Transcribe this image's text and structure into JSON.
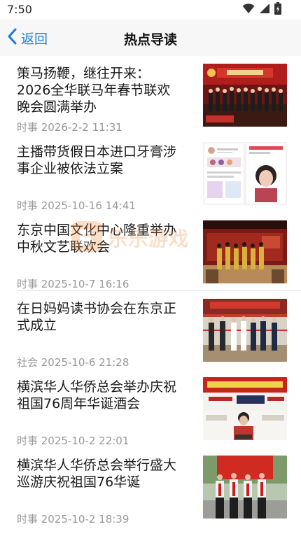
{
  "status_bar": {
    "time": "7:50",
    "icons": [
      "wifi-icon",
      "cellular-signal-icon",
      "battery-icon"
    ]
  },
  "nav": {
    "back_label": "返回",
    "title": "热点导读",
    "back_icon": "chevron-left-icon",
    "accent_color": "#1e7bd6"
  },
  "news": [
    {
      "title": "策马扬鞭，继往开来：2026全华联马年春节联欢晚会圆满举办",
      "meta": "时事 2026-2-2 11:31"
    },
    {
      "title": "主播带货假日本进口牙膏涉事企业被依法立案",
      "meta": "时事 2025-10-16 14:41"
    },
    {
      "title": "东京中国文化中心隆重举办中秋文艺联欢会",
      "meta": "时事 2025-10-7 16:16"
    },
    {
      "title": "在日妈妈读书协会在东京正式成立",
      "meta": "社会 2025-10-6 21:28"
    },
    {
      "title": "横滨华人华侨总会举办庆祝祖国76周年华诞酒会",
      "meta": "时事 2025-10-2 22:01"
    },
    {
      "title": "横滨华人华侨总会举行盛大巡游庆祝祖国76华诞",
      "meta": "时事 2025-10-2 18:39"
    }
  ],
  "watermark": {
    "text": "乐乐游戏",
    "icon": "game-logo-icon"
  }
}
